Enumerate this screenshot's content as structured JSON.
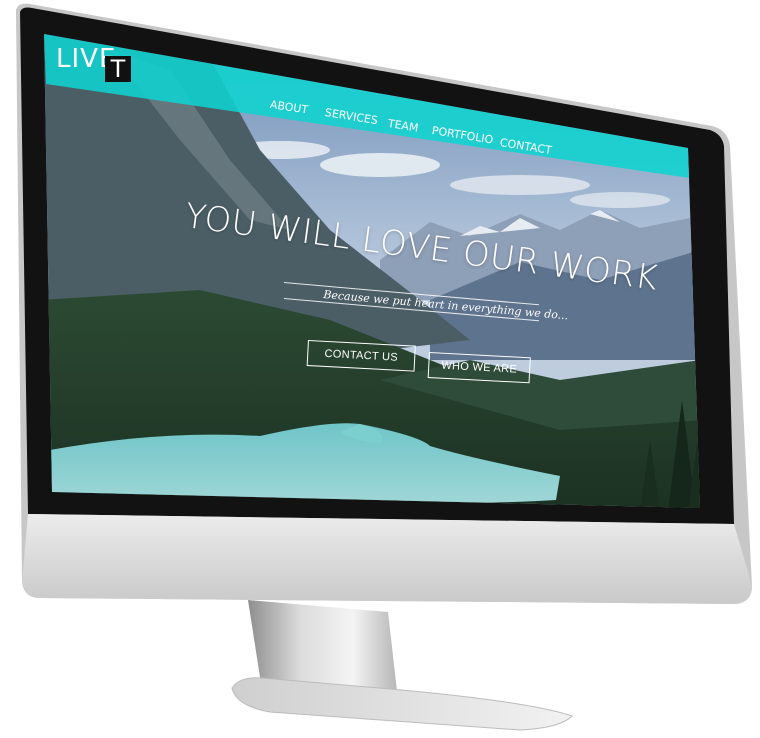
{
  "site": {
    "logo": {
      "text": "LIVE",
      "highlight": "T"
    },
    "nav": [
      {
        "label": "ABOUT"
      },
      {
        "label": "SERVICES"
      },
      {
        "label": "TEAM"
      },
      {
        "label": "PORTFOLIO"
      },
      {
        "label": "CONTACT"
      }
    ],
    "hero": {
      "title": "YOU WILL LOVE OUR WORK",
      "subtitle": "Because we put heart in everything we do...",
      "buttons": [
        {
          "label": "CONTACT US"
        },
        {
          "label": "WHO WE ARE"
        }
      ]
    }
  },
  "colors": {
    "accent": "#0fd4d0",
    "monitor_silver": "#d9d9d9",
    "bezel": "#111111"
  }
}
